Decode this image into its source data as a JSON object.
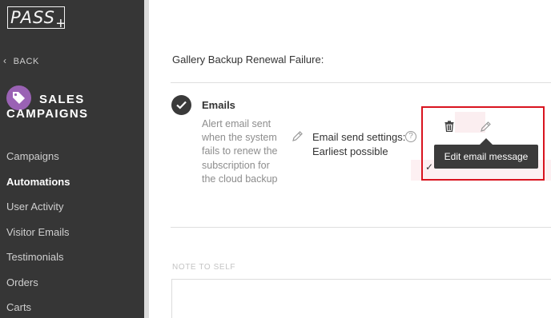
{
  "logo": {
    "text": "PASS",
    "plus": "+"
  },
  "sidebar": {
    "back_label": "BACK",
    "section_title_line1": "SALES",
    "section_title_line2": "CAMPAIGNS",
    "items": [
      {
        "label": "Campaigns",
        "active": false
      },
      {
        "label": "Automations",
        "active": true
      },
      {
        "label": "User Activity",
        "active": false
      },
      {
        "label": "Visitor Emails",
        "active": false
      },
      {
        "label": "Testimonials",
        "active": false
      },
      {
        "label": "Orders",
        "active": false
      },
      {
        "label": "Carts",
        "active": false
      }
    ]
  },
  "main": {
    "section_heading": "Gallery Backup Renewal Failure:",
    "email": {
      "title": "Emails",
      "description": "Alert email sent when the system fails to renew the subscription for the cloud backup",
      "send_settings_label": "Email send settings:",
      "send_settings_value": "Earliest possible",
      "help_symbol": "?",
      "tooltip": "Edit email message"
    },
    "note": {
      "label": "NOTE TO SELF",
      "value": ""
    }
  },
  "colors": {
    "sidebar_bg": "#363636",
    "badge": "#9a62b4",
    "highlight_border": "#d9141f",
    "tooltip_bg": "#3b3b3b"
  },
  "icons": [
    "back-chevron-icon",
    "tag-icon",
    "checkmark-icon",
    "pencil-icon",
    "help-icon",
    "trash-icon",
    "edit-pencil-icon"
  ]
}
